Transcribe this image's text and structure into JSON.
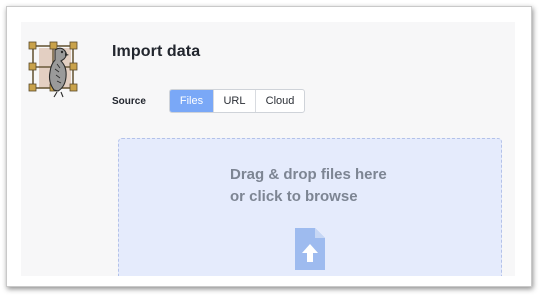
{
  "header": {
    "title": "Import data"
  },
  "source": {
    "label": "Source",
    "options": [
      "Files",
      "URL",
      "Cloud"
    ],
    "selected": "Files"
  },
  "dropzone": {
    "line1": "Drag & drop files here",
    "line2": "or click to browse",
    "icon": "file-upload-icon"
  },
  "colors": {
    "accent": "#7aa8f7",
    "dropzone_bg": "#e5ebfc",
    "icon": "#9ebbef",
    "panel_bg": "#f7f7f8"
  }
}
